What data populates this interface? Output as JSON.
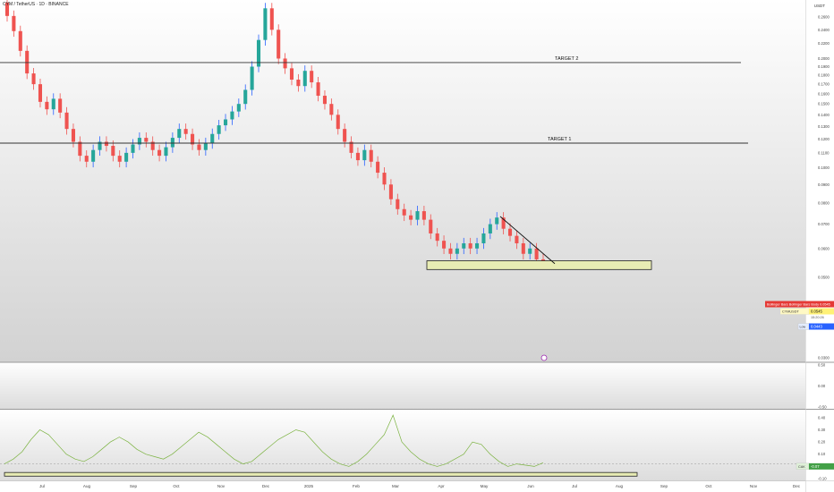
{
  "header": {
    "symbol_line": "CYM / TetherUS · 1D · BINANCE",
    "currency": "USDT"
  },
  "chart_data": [
    {
      "type": "candlestick",
      "pane": "price",
      "title": "CYM / TetherUS · 1D · BINANCE",
      "ylim": [
        0.03,
        0.285
      ],
      "y_scale": "log",
      "y_ticks": [
        "0.2600",
        "0.2400",
        "0.2200",
        "0.2000",
        "0.1900",
        "0.1800",
        "0.1700",
        "0.1600",
        "0.1500",
        "0.1400",
        "0.1300",
        "0.1200",
        "0.1100",
        "0.1000",
        "0.0900",
        "0.0800",
        "0.0700",
        "0.0600",
        "0.0500",
        "0.0400",
        "0.0300"
      ],
      "x_ticks": [
        "Jul",
        "Aug",
        "Sep",
        "Oct",
        "Nov",
        "Dec",
        "2025",
        "Feb",
        "Mar",
        "Apr",
        "May",
        "Jun",
        "Jul",
        "Aug",
        "Sep",
        "Oct",
        "Nov",
        "Dec"
      ],
      "series": [
        {
          "name": "",
          "points": [
            [
              0.285,
              0.262
            ],
            [
              0.262,
              0.238
            ],
            [
              0.238,
              0.21
            ],
            [
              0.21,
              0.182
            ],
            [
              0.182,
              0.17
            ],
            [
              0.17,
              0.152
            ],
            [
              0.152,
              0.145
            ],
            [
              0.145,
              0.155
            ],
            [
              0.155,
              0.142
            ],
            [
              0.142,
              0.128
            ],
            [
              0.128,
              0.118
            ],
            [
              0.118,
              0.108
            ],
            [
              0.108,
              0.104
            ],
            [
              0.104,
              0.112
            ],
            [
              0.112,
              0.118
            ],
            [
              0.118,
              0.115
            ],
            [
              0.115,
              0.108
            ],
            [
              0.108,
              0.104
            ],
            [
              0.104,
              0.11
            ],
            [
              0.11,
              0.116
            ],
            [
              0.116,
              0.121
            ],
            [
              0.121,
              0.118
            ],
            [
              0.118,
              0.112
            ],
            [
              0.112,
              0.108
            ],
            [
              0.108,
              0.114
            ],
            [
              0.114,
              0.121
            ],
            [
              0.121,
              0.128
            ],
            [
              0.128,
              0.124
            ],
            [
              0.124,
              0.116
            ],
            [
              0.116,
              0.112
            ],
            [
              0.112,
              0.117
            ],
            [
              0.117,
              0.124
            ],
            [
              0.124,
              0.131
            ],
            [
              0.131,
              0.136
            ],
            [
              0.136,
              0.143
            ],
            [
              0.143,
              0.15
            ],
            [
              0.15,
              0.164
            ],
            [
              0.164,
              0.19
            ],
            [
              0.19,
              0.225
            ],
            [
              0.225,
              0.275
            ],
            [
              0.275,
              0.24
            ],
            [
              0.24,
              0.2
            ],
            [
              0.2,
              0.188
            ],
            [
              0.188,
              0.175
            ],
            [
              0.175,
              0.168
            ],
            [
              0.168,
              0.185
            ],
            [
              0.185,
              0.172
            ],
            [
              0.172,
              0.158
            ],
            [
              0.158,
              0.15
            ],
            [
              0.15,
              0.14
            ],
            [
              0.14,
              0.128
            ],
            [
              0.128,
              0.118
            ],
            [
              0.118,
              0.11
            ],
            [
              0.11,
              0.105
            ],
            [
              0.105,
              0.112
            ],
            [
              0.112,
              0.104
            ],
            [
              0.104,
              0.097
            ],
            [
              0.097,
              0.09
            ],
            [
              0.09,
              0.082
            ],
            [
              0.082,
              0.077
            ],
            [
              0.077,
              0.074
            ],
            [
              0.074,
              0.072
            ],
            [
              0.072,
              0.076
            ],
            [
              0.076,
              0.072
            ],
            [
              0.072,
              0.066
            ],
            [
              0.066,
              0.063
            ],
            [
              0.063,
              0.06
            ],
            [
              0.06,
              0.058
            ],
            [
              0.058,
              0.06
            ],
            [
              0.06,
              0.062
            ],
            [
              0.062,
              0.06
            ],
            [
              0.06,
              0.062
            ],
            [
              0.062,
              0.066
            ],
            [
              0.066,
              0.07
            ],
            [
              0.07,
              0.073
            ],
            [
              0.073,
              0.068
            ],
            [
              0.068,
              0.065
            ],
            [
              0.065,
              0.062
            ],
            [
              0.062,
              0.058
            ],
            [
              0.058,
              0.06
            ],
            [
              0.06,
              0.056
            ],
            [
              0.056,
              0.0545
            ]
          ]
        }
      ],
      "levels": [
        {
          "label": "TARGET 2",
          "value": 0.195
        },
        {
          "label": "TARGET 1",
          "value": 0.117
        }
      ],
      "support_zone": [
        0.0525,
        0.0555
      ],
      "descending_trendline": [
        0.0735,
        0.0545
      ],
      "price_tags": [
        {
          "text": "Bollinger Bars Bollinger Bars Body",
          "value": "0.0545",
          "color": "#e53935"
        },
        {
          "text": "CYMUSDT",
          "value": "0.0545",
          "sub": "15:20:26",
          "color": "#fff176"
        },
        {
          "text": "Low",
          "value": "0.0443",
          "color": "#2962ff"
        }
      ],
      "colors": {
        "up": "#26a69a",
        "down": "#ef5350",
        "wick_up": "#2962ff",
        "wick_down": "#ef5350"
      }
    },
    {
      "type": "line",
      "pane": "indicator-1",
      "y_ticks": [
        "0.50",
        "0.00",
        "-0.50"
      ],
      "ylim": [
        -0.5,
        0.5
      ],
      "series": []
    },
    {
      "type": "line",
      "pane": "indicator-2",
      "ylim": [
        -0.1,
        0.45
      ],
      "y_ticks": [
        "0.40",
        "0.30",
        "0.20",
        "0.10",
        "0.00",
        "-0.10"
      ],
      "series": [
        {
          "name": "",
          "values": [
            0.02,
            0.06,
            0.12,
            0.22,
            0.3,
            0.26,
            0.18,
            0.1,
            0.06,
            0.04,
            0.08,
            0.14,
            0.2,
            0.24,
            0.2,
            0.14,
            0.1,
            0.08,
            0.06,
            0.1,
            0.16,
            0.22,
            0.28,
            0.24,
            0.18,
            0.12,
            0.06,
            0.02,
            0.04,
            0.1,
            0.16,
            0.22,
            0.26,
            0.3,
            0.28,
            0.2,
            0.12,
            0.06,
            0.02,
            0.0,
            0.04,
            0.1,
            0.18,
            0.26,
            0.42,
            0.2,
            0.12,
            0.06,
            0.02,
            0.0,
            0.02,
            0.06,
            0.1,
            0.2,
            0.18,
            0.1,
            0.04,
            0.0,
            0.02,
            0.01,
            0.0,
            0.03
          ]
        }
      ],
      "value_tag": {
        "label": "CAK",
        "value": "-0.07",
        "color": "#43a047"
      },
      "support_zone": [
        -0.08,
        -0.05
      ],
      "dashed_level": 0.02
    }
  ]
}
